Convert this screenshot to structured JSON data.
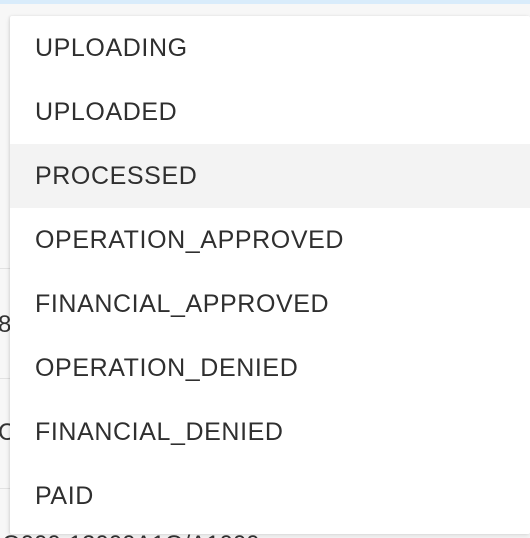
{
  "dropdown": {
    "options": [
      {
        "label": "UPLOADING"
      },
      {
        "label": "UPLOADED"
      },
      {
        "label": "PROCESSED",
        "highlighted": true
      },
      {
        "label": "OPERATION_APPROVED"
      },
      {
        "label": "FINANCIAL_APPROVED"
      },
      {
        "label": "OPERATION_DENIED"
      },
      {
        "label": "FINANCIAL_DENIED"
      },
      {
        "label": "PAID"
      }
    ]
  }
}
